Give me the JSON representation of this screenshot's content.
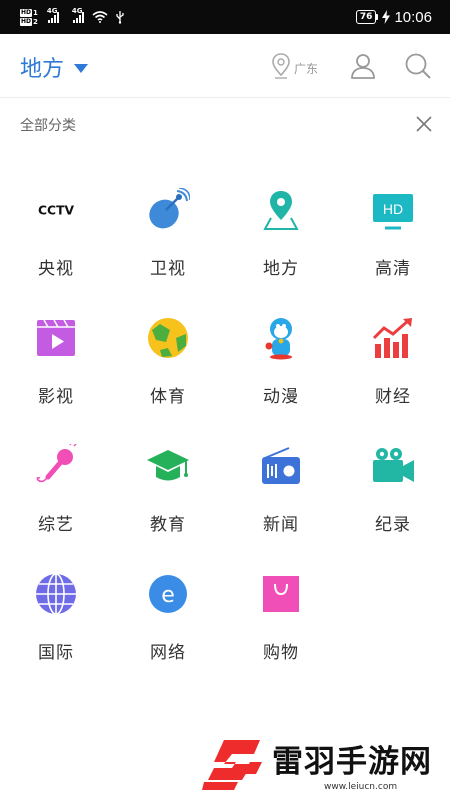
{
  "status_bar": {
    "sim1_badge": "HD",
    "sim1_slot": "1",
    "sim2_badge": "HD",
    "sim2_slot": "2",
    "network1": "4G",
    "network2": "4G",
    "battery": "76",
    "time": "10:06"
  },
  "header": {
    "region_label": "地方",
    "location_label": "广东",
    "accent_color": "#2f7ad6"
  },
  "section": {
    "title": "全部分类"
  },
  "categories": [
    {
      "label": "央视",
      "icon": "cctv-logo-icon"
    },
    {
      "label": "卫视",
      "icon": "satellite-dish-icon"
    },
    {
      "label": "地方",
      "icon": "map-pin-icon"
    },
    {
      "label": "高清",
      "icon": "hd-screen-icon"
    },
    {
      "label": "影视",
      "icon": "film-play-icon"
    },
    {
      "label": "体育",
      "icon": "soccer-ball-icon"
    },
    {
      "label": "动漫",
      "icon": "doraemon-icon"
    },
    {
      "label": "财经",
      "icon": "finance-chart-icon"
    },
    {
      "label": "综艺",
      "icon": "microphone-icon"
    },
    {
      "label": "教育",
      "icon": "graduation-cap-icon"
    },
    {
      "label": "新闻",
      "icon": "radio-icon"
    },
    {
      "label": "纪录",
      "icon": "video-camera-icon"
    },
    {
      "label": "国际",
      "icon": "globe-icon"
    },
    {
      "label": "网络",
      "icon": "internet-e-icon"
    },
    {
      "label": "购物",
      "icon": "shopping-bag-icon"
    }
  ],
  "icon_text": {
    "cctv": "CCTV",
    "hd": "HD",
    "e": "e"
  },
  "watermark": {
    "title": "雷羽手游网",
    "url": "www.leiucn.com"
  }
}
